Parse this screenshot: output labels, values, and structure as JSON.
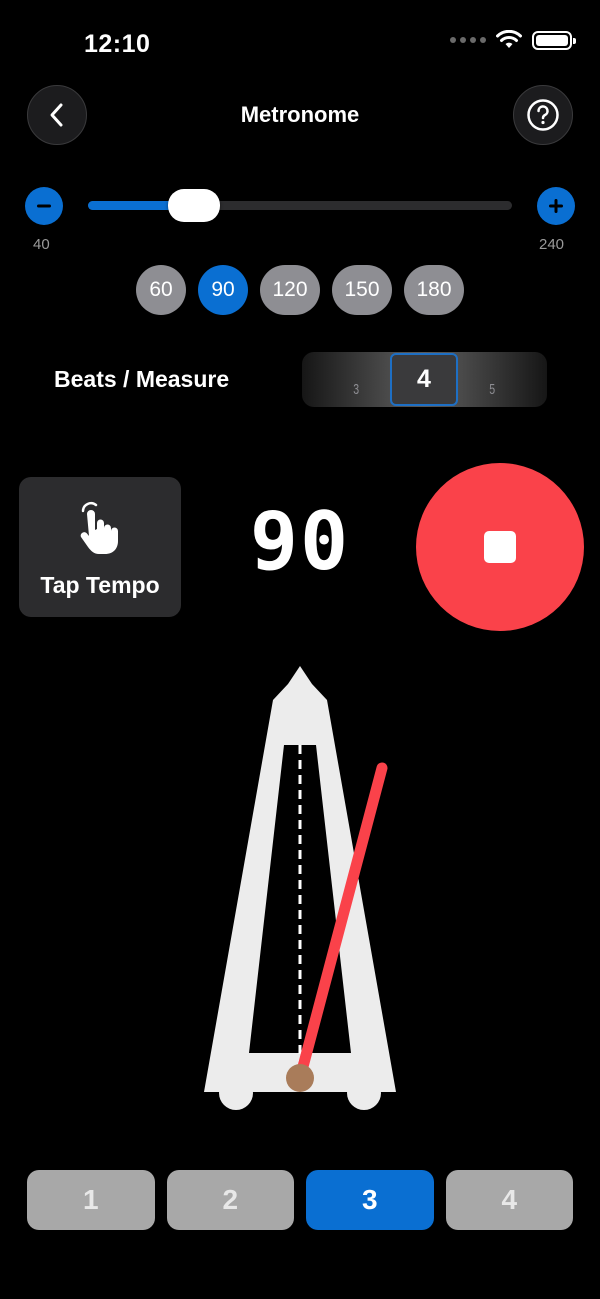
{
  "status": {
    "time": "12:10"
  },
  "nav": {
    "title": "Metronome",
    "back_icon": "chevron-left-icon",
    "help_icon": "question-circle-icon"
  },
  "tempo": {
    "min": "40",
    "max": "240",
    "value": 90,
    "minus_icon": "minus-icon",
    "plus_icon": "plus-icon",
    "presets": [
      "60",
      "90",
      "120",
      "150",
      "180"
    ],
    "active_preset": "90"
  },
  "beats": {
    "label": "Beats / Measure",
    "selected": "4",
    "prev": "3",
    "next": "5"
  },
  "tap_tempo": {
    "label": "Tap Tempo",
    "icon": "hand-tap-icon"
  },
  "bpm_display": "90",
  "stop": {
    "icon": "stop-icon"
  },
  "beat_indicators": [
    "1",
    "2",
    "3",
    "4"
  ],
  "active_beat": "3",
  "colors": {
    "accent": "#0a6fd2",
    "stop": "#fa424a",
    "pendulum": "#fa424a",
    "bob": "#a97c5a"
  }
}
